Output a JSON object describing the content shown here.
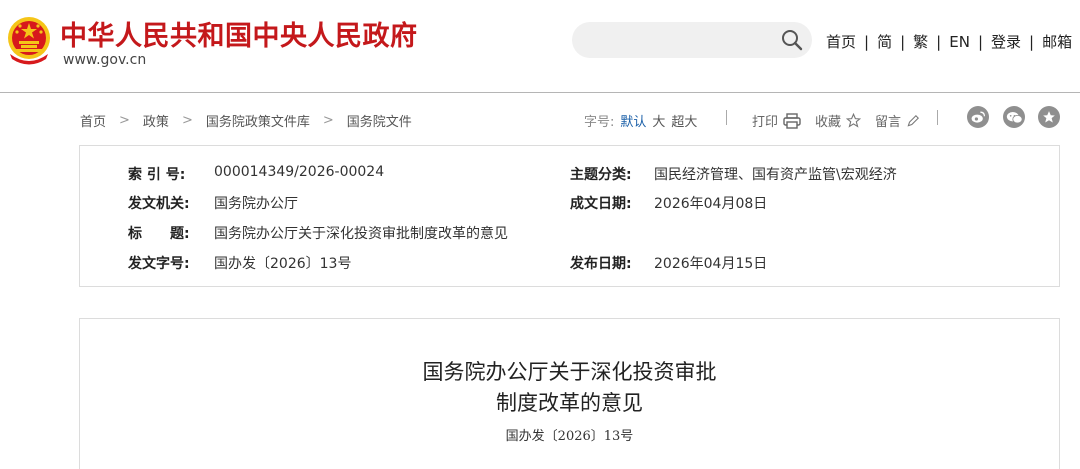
{
  "header": {
    "site_name": "中华人民共和国中央人民政府",
    "site_url": "www.gov.cn",
    "search_placeholder": "",
    "nav": [
      {
        "label": "首页"
      },
      {
        "label": "简"
      },
      {
        "label": "繁"
      },
      {
        "label": "EN"
      },
      {
        "label": "登录"
      },
      {
        "label": "邮箱"
      }
    ],
    "nav_separator": "|"
  },
  "breadcrumb": {
    "items": [
      "首页",
      "政策",
      "国务院政策文件库",
      "国务院文件"
    ],
    "separator": ">"
  },
  "tools": {
    "fontsize_label": "字号:",
    "fontsize_options": [
      "默认",
      "大",
      "超大"
    ],
    "fontsize_active": "默认",
    "print_label": "打印",
    "favorite_label": "收藏",
    "comment_label": "留言",
    "share_icons": [
      "weibo-icon",
      "wechat-icon",
      "favorite-star-icon"
    ]
  },
  "info": {
    "index_label": "索 引 号:",
    "index_value": "000014349/2026-00024",
    "topic_label": "主题分类:",
    "topic_value": "国民经济管理、国有资产监管\\宏观经济",
    "issuer_label": "发文机关:",
    "issuer_value": "国务院办公厅",
    "created_label": "成文日期:",
    "created_value": "2026年04月08日",
    "title_label": "标　　题:",
    "title_value": "国务院办公厅关于深化投资审批制度改革的意见",
    "docno_label": "发文字号:",
    "docno_value": "国办发〔2026〕13号",
    "published_label": "发布日期:",
    "published_value": "2026年04月15日"
  },
  "article": {
    "title_line1": "国务院办公厅关于深化投资审批",
    "title_line2": "制度改革的意见",
    "doc_number": "国办发〔2026〕13号"
  },
  "colors": {
    "brand_red": "#c4181b",
    "emblem_gold": "#f5c518",
    "link_active": "#1a5fa8",
    "border": "#dcdcdc"
  }
}
